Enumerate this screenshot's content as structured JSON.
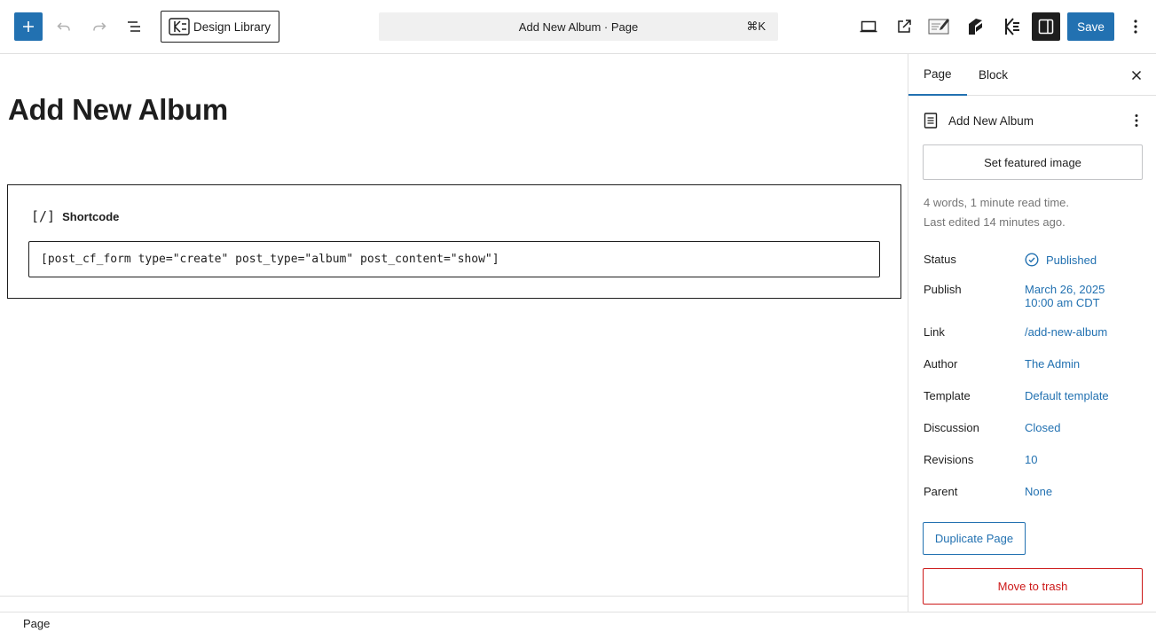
{
  "toolbar": {
    "design_library_label": "Design Library",
    "command_bar_text": "Add New Album · Page",
    "command_shortcut": "⌘K",
    "save_label": "Save",
    "accent_color": "#2271b1"
  },
  "editor": {
    "title": "Add New Album",
    "block": {
      "label": "Shortcode",
      "icon": "[/]",
      "value": "[post_cf_form type=\"create\" post_type=\"album\" post_content=\"show\"]"
    }
  },
  "sidebar": {
    "tabs": [
      "Page",
      "Block"
    ],
    "active_tab": "Page",
    "document_title": "Add New Album",
    "featured_image_label": "Set featured image",
    "stats": "4 words, 1 minute read time.",
    "last_edited": "Last edited 14 minutes ago.",
    "fields": [
      {
        "label": "Status",
        "value": "Published"
      },
      {
        "label": "Publish",
        "value": "March 26, 2025",
        "value2": "10:00 am CDT"
      },
      {
        "label": "Link",
        "value": "/add-new-album"
      },
      {
        "label": "Author",
        "value": "The Admin"
      },
      {
        "label": "Template",
        "value": "Default template"
      },
      {
        "label": "Discussion",
        "value": "Closed"
      },
      {
        "label": "Revisions",
        "value": "10"
      },
      {
        "label": "Parent",
        "value": "None"
      }
    ],
    "duplicate_label": "Duplicate Page",
    "trash_label": "Move to trash"
  },
  "statusbar": {
    "breadcrumb": "Page"
  }
}
